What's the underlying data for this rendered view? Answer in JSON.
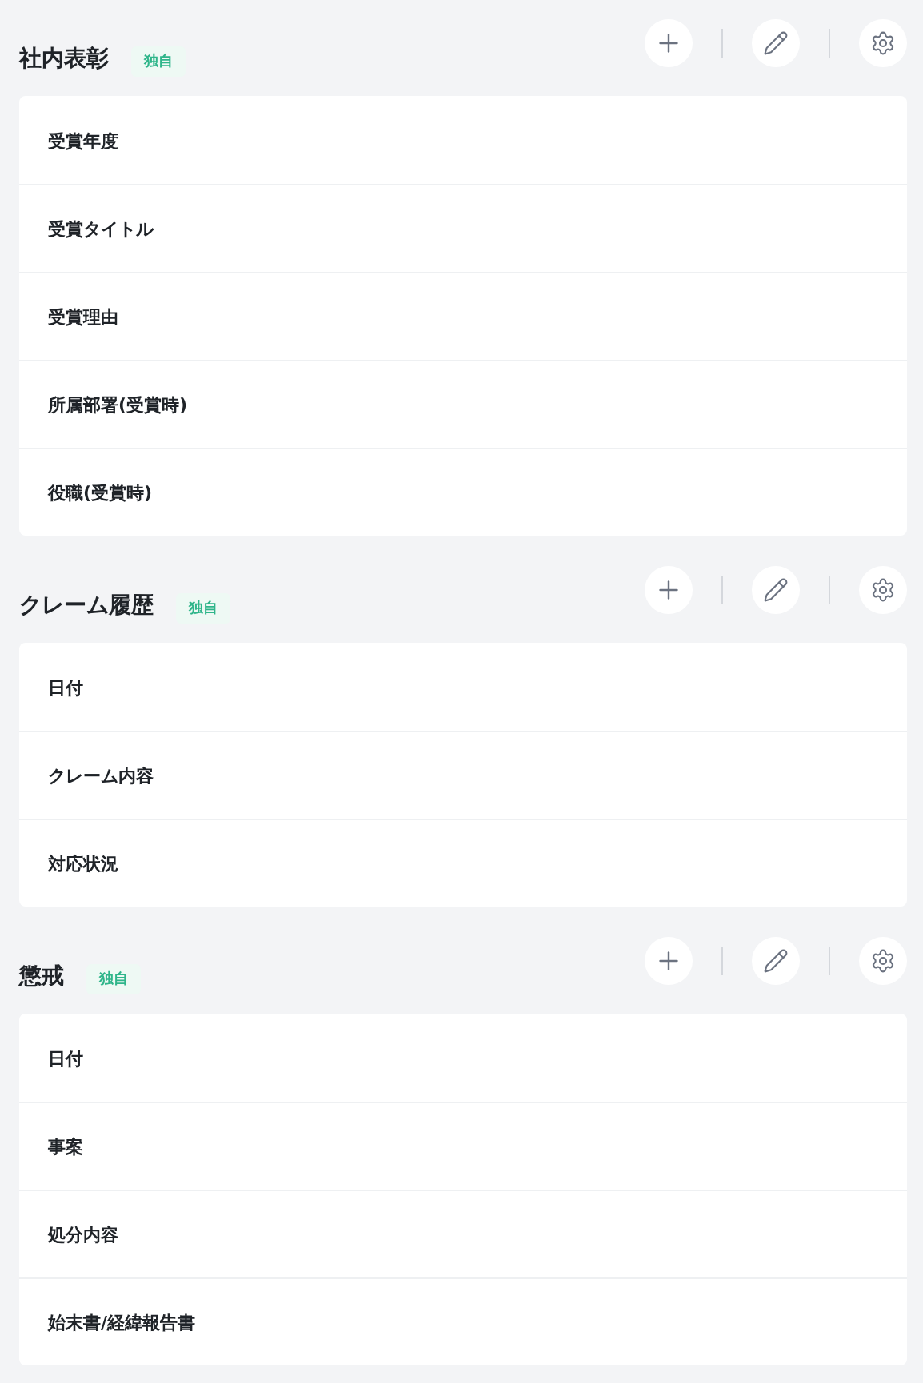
{
  "sections": [
    {
      "title": "社内表彰",
      "badge": "独自",
      "fields": [
        "受賞年度",
        "受賞タイトル",
        "受賞理由",
        "所属部署(受賞時)",
        "役職(受賞時)"
      ]
    },
    {
      "title": "クレーム履歴",
      "badge": "独自",
      "fields": [
        "日付",
        "クレーム内容",
        "対応状況"
      ]
    },
    {
      "title": "懲戒",
      "badge": "独自",
      "fields": [
        "日付",
        "事案",
        "処分内容",
        "始末書/経緯報告書"
      ]
    }
  ]
}
